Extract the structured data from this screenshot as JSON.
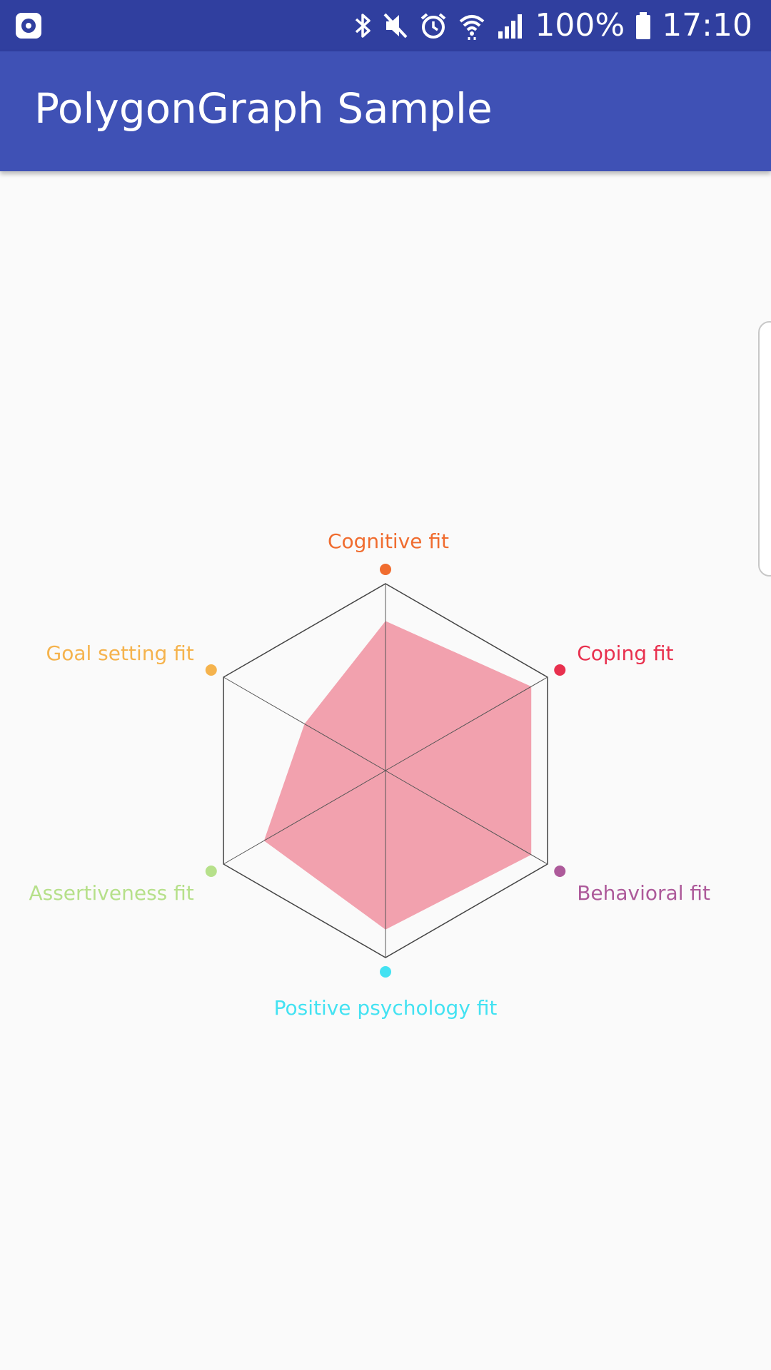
{
  "status_bar": {
    "battery_text": "100%",
    "time_text": "17:10",
    "icons": [
      "screen-record-icon",
      "bluetooth-icon",
      "mute-icon",
      "alarm-icon",
      "wifi-icon",
      "signal-icon",
      "battery-icon"
    ]
  },
  "app_bar": {
    "title": "PolygonGraph Sample"
  },
  "colors": {
    "status_bar": "#303f9f",
    "app_bar": "#3f51b5",
    "background": "#fafafa",
    "fill": "#f2a1ae"
  },
  "chart_data": {
    "type": "radar",
    "max": 1.0,
    "axes": [
      {
        "label": "Cognitive fit",
        "color": "#f06c2f",
        "value": 0.8
      },
      {
        "label": "Coping fit",
        "color": "#e8304e",
        "value": 0.9
      },
      {
        "label": "Behavioral fit",
        "color": "#ad5a9a",
        "value": 0.9
      },
      {
        "label": "Positive psychology fit",
        "color": "#43e2f2",
        "value": 0.85
      },
      {
        "label": "Assertiveness fit",
        "color": "#b6e08a",
        "value": 0.75
      },
      {
        "label": "Goal setting fit",
        "color": "#f5b34d",
        "value": 0.5
      }
    ]
  }
}
